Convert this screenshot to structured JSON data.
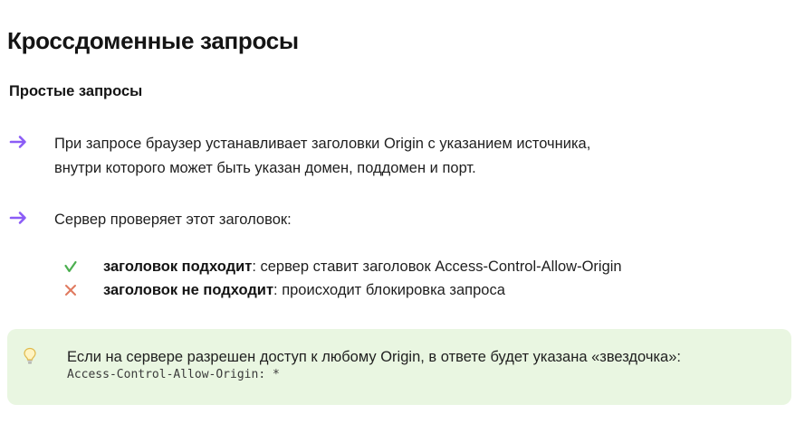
{
  "page": {
    "title": "Кроссдоменные запросы",
    "section_title": "Простые запросы"
  },
  "bullets": [
    {
      "icon": "arrow-right-icon",
      "line1": "При запросе браузер устанавливает заголовки Origin с указанием источника,",
      "line2": "внутри которого может быть указан домен, поддомен и порт."
    },
    {
      "icon": "arrow-right-icon",
      "line1": "Сервер проверяет этот заголовок:"
    }
  ],
  "sub_items": [
    {
      "icon": "check-icon",
      "bold": "заголовок подходит",
      "rest": ": сервер ставит заголовок Access-Control-Allow-Origin"
    },
    {
      "icon": "cross-icon",
      "bold": "заголовок не подходит",
      "rest": ": происходит блокировка запроса"
    }
  ],
  "note": {
    "icon": "lightbulb-icon",
    "text": "Если на сервере разрешен доступ к любому Origin, в ответе будет указана «звездочка»:",
    "code": "Access-Control-Allow-Origin: *"
  },
  "colors": {
    "arrow": "#8b5cf6",
    "check": "#4caf50",
    "cross": "#e07a5f",
    "note_bg": "#e9f6e1"
  }
}
